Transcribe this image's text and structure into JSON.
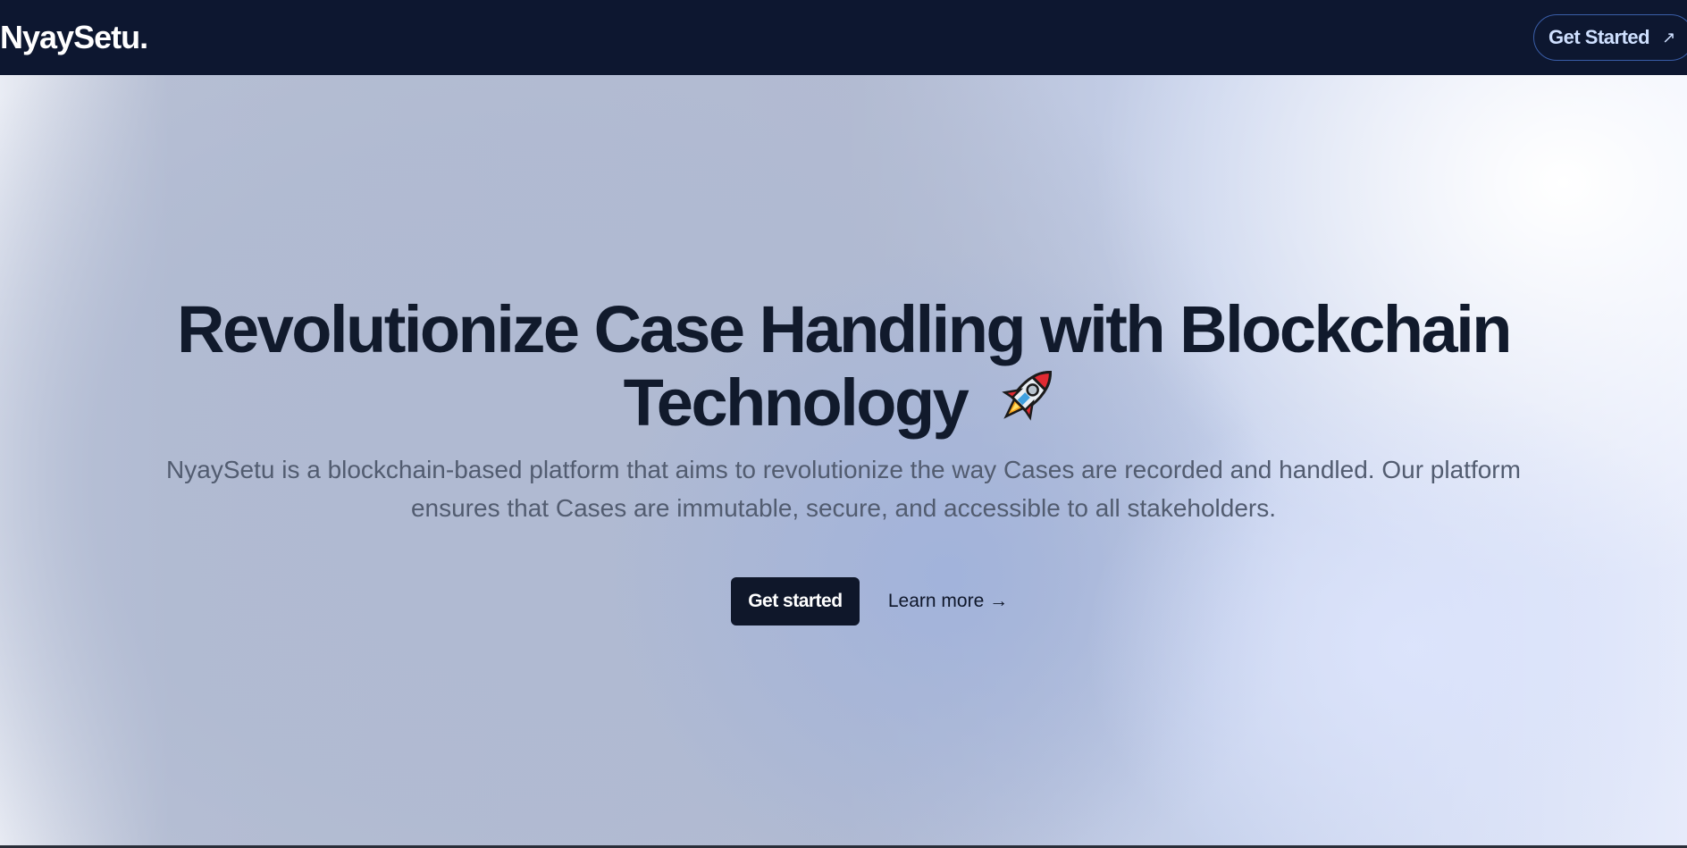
{
  "nav": {
    "logo": "NyaySetu.",
    "cta_label": "Get Started",
    "cta_icon": "arrow-up-right-icon"
  },
  "hero": {
    "headline_line1": "Revolutionize Case Handling with Blockchain",
    "headline_line2": "Technology",
    "headline_emoji": "rocket-icon",
    "description": "NyaySetu is a blockchain-based platform that aims to revolutionize the way Cases are recorded and handled. Our platform ensures that Cases are immutable, secure, and accessible to all stakeholders.",
    "primary_button": "Get started",
    "secondary_link": "Learn more →"
  },
  "colors": {
    "nav_bg": "#0d1730",
    "headline": "#111a2c",
    "body_text": "#525c70",
    "primary_button_bg": "#0f172a"
  }
}
